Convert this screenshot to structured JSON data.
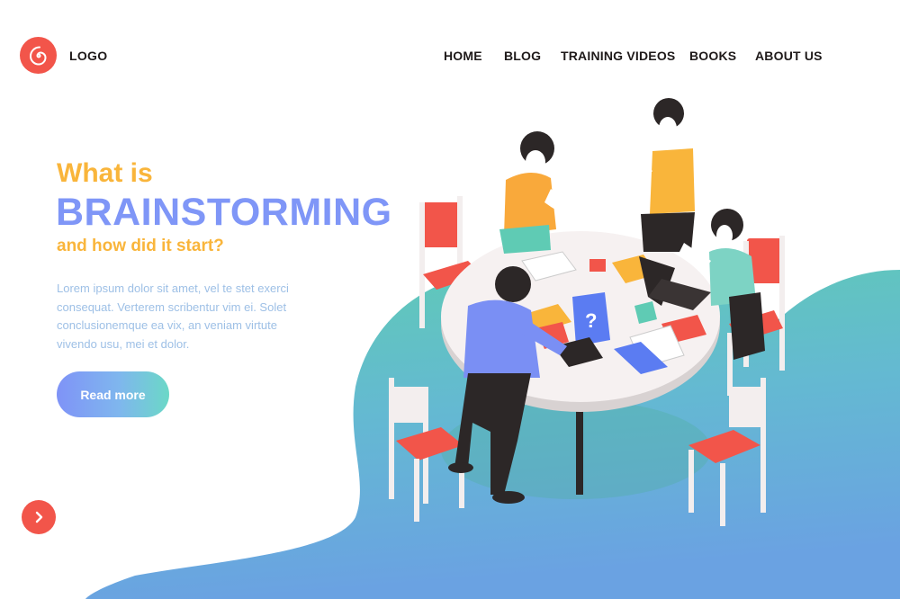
{
  "brand": {
    "logo_text": "LOGO",
    "icon": "spiral-logo-icon",
    "color": "#f2554a"
  },
  "nav": [
    "HOME",
    "BLOG",
    "TRAINING VIDEOS",
    "BOOKS",
    "ABOUT US"
  ],
  "hero": {
    "heading_line1": "What is",
    "heading_line2": "BRAINSTORMING",
    "heading_line3": "and how did it start?",
    "body": "Lorem ipsum dolor sit amet, vel te stet exerci consequat. Verterem scribentur vim ei. Solet conclusionemque ea vix, an veniam virtute vivendo usu, mei et dolor.",
    "cta_label": "Read more"
  },
  "next_button": {
    "icon": "chevron-right-icon"
  },
  "colors": {
    "accent_orange": "#f9b53b",
    "accent_blue": "#7f96f7",
    "body_text": "#9ec0e6",
    "blob_green": "#5fcbb4",
    "blob_blue": "#6aa2e2"
  }
}
